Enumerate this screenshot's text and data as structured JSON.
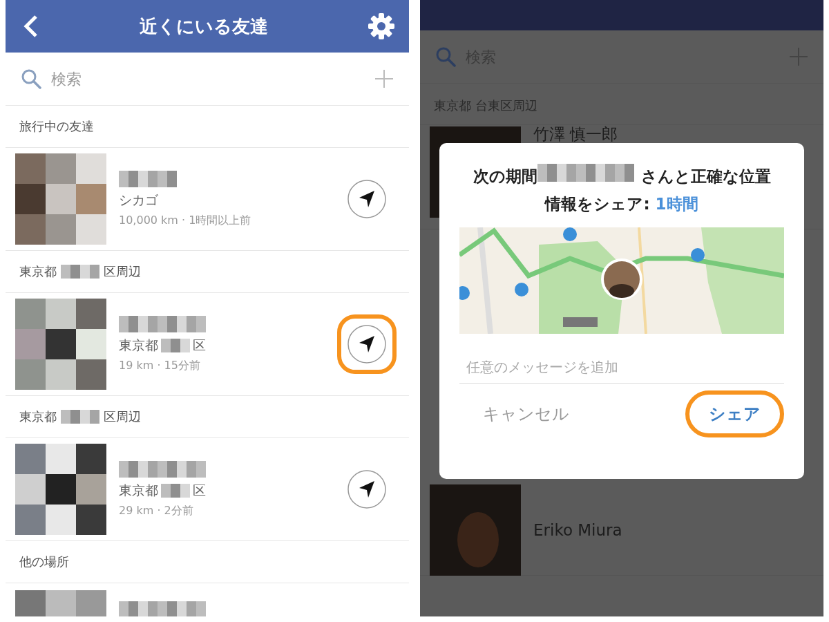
{
  "left": {
    "header": {
      "title": "近くにいる友達"
    },
    "search": {
      "placeholder": "検索"
    },
    "sections": [
      {
        "kind": "plain",
        "title": "旅行中の友達",
        "friends": [
          {
            "location": "シカゴ",
            "distance": "10,000 km · 1時間以上前",
            "highlighted": false
          }
        ]
      },
      {
        "kind": "redacted",
        "before": "東京都",
        "after": "区周辺",
        "friends": [
          {
            "location_before": "東京都",
            "location_after": "区",
            "distance": "19 km · 15分前",
            "highlighted": true
          }
        ]
      },
      {
        "kind": "redacted",
        "before": "東京都",
        "after": "区周辺",
        "friends": [
          {
            "location_before": "東京都",
            "location_after": "区",
            "distance": "29 km · 2分前",
            "highlighted": false
          }
        ]
      },
      {
        "kind": "plain",
        "title": "他の場所",
        "friends": [
          {
            "kind": "partial"
          }
        ]
      }
    ]
  },
  "right": {
    "search": {
      "placeholder": "検索"
    },
    "section": "東京都 台東区周辺",
    "friend": "竹澤 慎一郎",
    "other_friend": "Eriko Miura",
    "dialog": {
      "title_before": "次の期間",
      "title_after": "さんと正確な位置情報をシェア:",
      "duration": "1時間",
      "message_placeholder": "任意のメッセージを追加",
      "buttons": [
        {
          "label": "キャンセル",
          "kind": "cancel",
          "highlighted": false
        },
        {
          "label": "シェア",
          "kind": "confirm",
          "highlighted": true
        }
      ]
    }
  }
}
